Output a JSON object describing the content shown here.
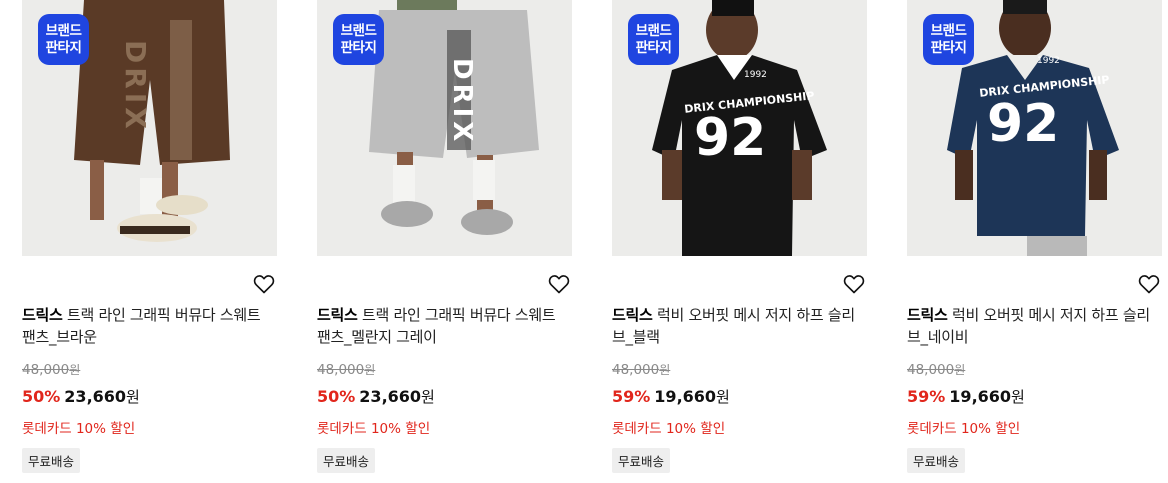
{
  "products": [
    {
      "badge_line1": "브랜드",
      "badge_line2": "판타지",
      "brand": "드릭스",
      "title": "트랙 라인 그래픽 버뮤다 스웨트 팬츠_브라운",
      "original_price": "48,000",
      "original_unit": "원",
      "discount": "50%",
      "price": "23,660",
      "price_unit": "원",
      "promo": "롯데카드 10% 할인",
      "shipping": "무료배송",
      "image_color": "#5a3a26"
    },
    {
      "badge_line1": "브랜드",
      "badge_line2": "판타지",
      "brand": "드릭스",
      "title": "트랙 라인 그래픽 버뮤다 스웨트 팬츠_멜란지 그레이",
      "original_price": "48,000",
      "original_unit": "원",
      "discount": "50%",
      "price": "23,660",
      "price_unit": "원",
      "promo": "롯데카드 10% 할인",
      "shipping": "무료배송",
      "image_color": "#b9b9b9"
    },
    {
      "badge_line1": "브랜드",
      "badge_line2": "판타지",
      "brand": "드릭스",
      "title": "럭비 오버핏 메시 저지 하프 슬리브_블랙",
      "original_price": "48,000",
      "original_unit": "원",
      "discount": "59%",
      "price": "19,660",
      "price_unit": "원",
      "promo": "롯데카드 10% 할인",
      "shipping": "무료배송",
      "image_color": "#151515"
    },
    {
      "badge_line1": "브랜드",
      "badge_line2": "판타지",
      "brand": "드릭스",
      "title": "럭비 오버핏 메시 저지 하프 슬리브_네이비",
      "original_price": "48,000",
      "original_unit": "원",
      "discount": "59%",
      "price": "19,660",
      "price_unit": "원",
      "promo": "롯데카드 10% 할인",
      "shipping": "무료배송",
      "image_color": "#1d3557"
    }
  ],
  "image_texts": {
    "shorts_logo": "DRIX",
    "jersey_header": "DRIX CHAMPIONSHIP",
    "jersey_number": "92",
    "jersey_year": "1992"
  },
  "colors": {
    "accent_red": "#e1261c",
    "badge_blue": "#1f45e0",
    "strike_gray": "#8a8a8a"
  },
  "icons": {
    "wishlist": "heart-outline-icon"
  }
}
